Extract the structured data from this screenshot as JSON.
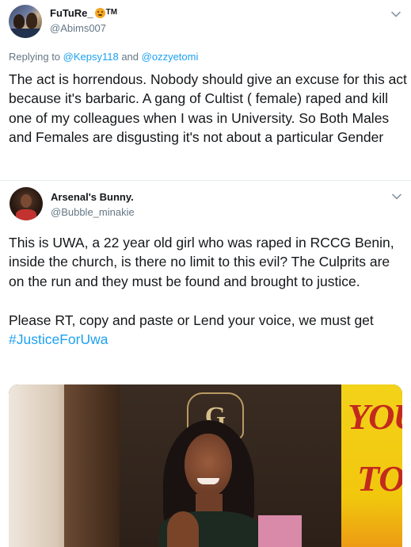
{
  "tweet1": {
    "name": "FuTuRe_",
    "name_suffix": "TM",
    "name_emoji": "lion-face-icon",
    "handle": "@Abims007",
    "replying_prefix": "Replying to ",
    "reply_to_1": "@Kepsy118",
    "replying_and": " and ",
    "reply_to_2": "@ozzyetomi",
    "text": "The act is horrendous. Nobody should give an excuse for this act because it's barbaric. A gang of Cultist ( female) raped and kill one of my colleagues when I was in University. So Both Males and Females are disgusting it's not about a particular Gender",
    "menu_icon": "chevron-down-icon"
  },
  "tweet2": {
    "name": "Arsenal's Bunny.",
    "handle": "@Bubble_minakie",
    "paragraph1": "This is UWA, a 22 year old girl who was raped in RCCG Benin, inside the church, is there no limit to this evil? The Culprits are on the run and they must be found and brought to justice.",
    "paragraph2_text": "Please RT, copy and paste or Lend your voice, we must get ",
    "hashtag": "#JusticeForUwa",
    "menu_icon": "chevron-down-icon",
    "photo": {
      "logo_letter": "G",
      "sign_line1": "YOU",
      "sign_line2": "TO"
    }
  },
  "colors": {
    "link": "#1da1f2",
    "secondary": "#657786",
    "text": "#14171a",
    "divider": "#e6ecf0"
  }
}
